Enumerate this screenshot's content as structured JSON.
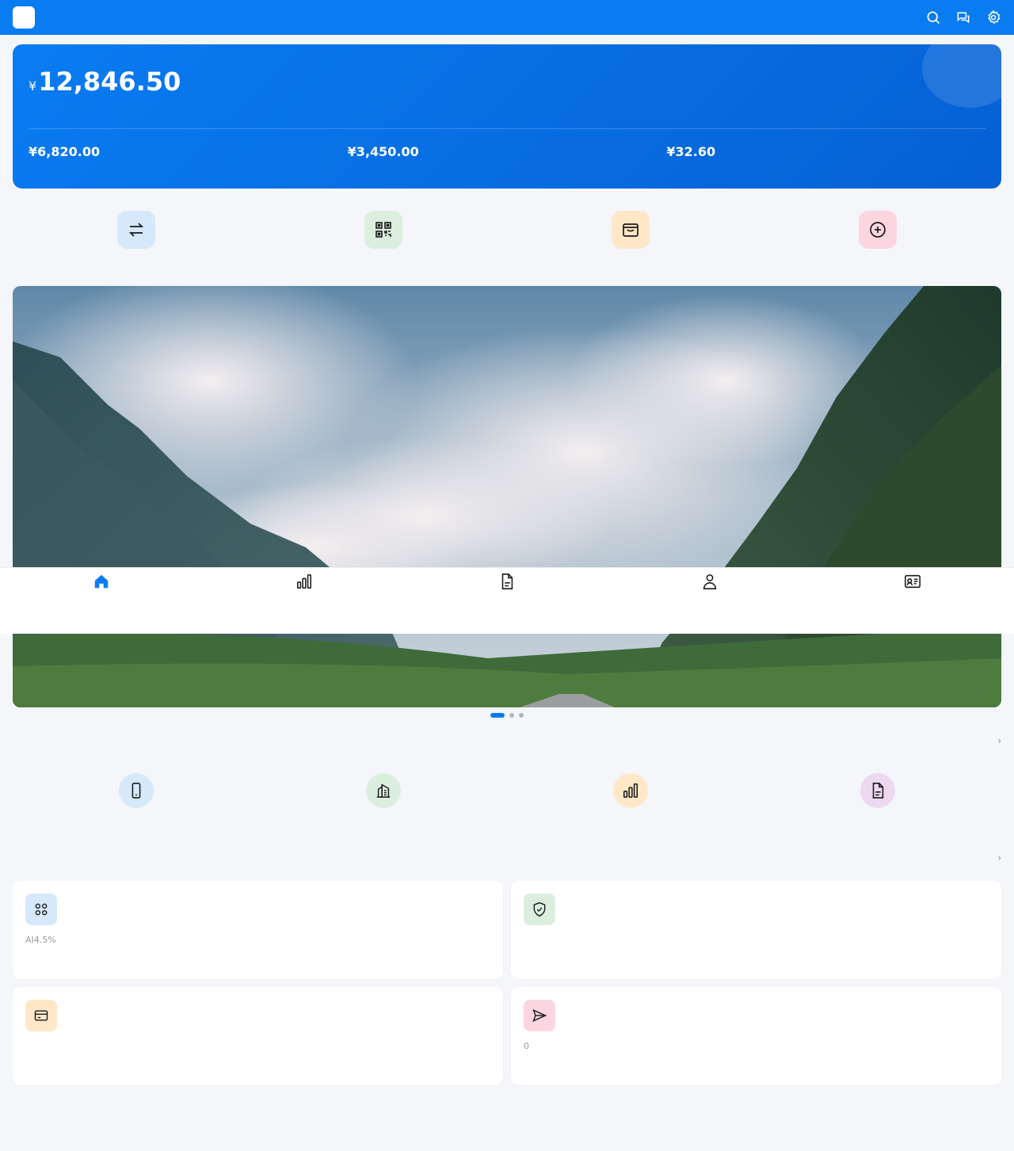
{
  "header": {
    "logo_glyph": "",
    "title": "",
    "icons": [
      "search-icon",
      "chat-icon",
      "settings-icon"
    ]
  },
  "balance": {
    "label": "",
    "currency": "¥",
    "amount": "12,846.50",
    "sub": [
      {
        "label": "",
        "value": "¥6,820.00"
      },
      {
        "label": "",
        "value": "¥3,450.00"
      },
      {
        "label": "",
        "value": "¥32.60"
      }
    ]
  },
  "quick_actions": [
    {
      "label": "",
      "icon": "transfer-icon"
    },
    {
      "label": "",
      "icon": "qr-code-icon"
    },
    {
      "label": "",
      "icon": "wallet-icon"
    },
    {
      "label": "",
      "icon": "add-circle-icon"
    }
  ],
  "banner": {
    "pages": 3,
    "active": 0
  },
  "services": {
    "title": "",
    "more": " ›",
    "items": [
      {
        "label": "",
        "icon": "mobile-icon"
      },
      {
        "label": "",
        "icon": "building-icon"
      },
      {
        "label": "",
        "icon": "bar-chart-icon"
      },
      {
        "label": "",
        "icon": "document-icon"
      }
    ]
  },
  "recommended": {
    "title": "",
    "more": " ›",
    "cards": [
      {
        "title": "",
        "desc": "AI4.5%",
        "icon": "grid-icon"
      },
      {
        "title": "",
        "desc": "",
        "icon": "shield-check-icon"
      },
      {
        "title": "",
        "desc": "",
        "icon": "credit-card-icon"
      },
      {
        "title": "",
        "desc": "0",
        "icon": "send-icon"
      }
    ]
  },
  "tabbar": {
    "active": 0,
    "tabs": [
      {
        "label": "",
        "icon": "home-icon"
      },
      {
        "label": "",
        "icon": "bar-chart-icon"
      },
      {
        "label": "",
        "icon": "document-icon"
      },
      {
        "label": "",
        "icon": "user-icon"
      },
      {
        "label": "",
        "icon": "id-card-icon"
      }
    ]
  },
  "colors": {
    "primary": "#0a7cf2",
    "background": "#f4f6fa"
  }
}
